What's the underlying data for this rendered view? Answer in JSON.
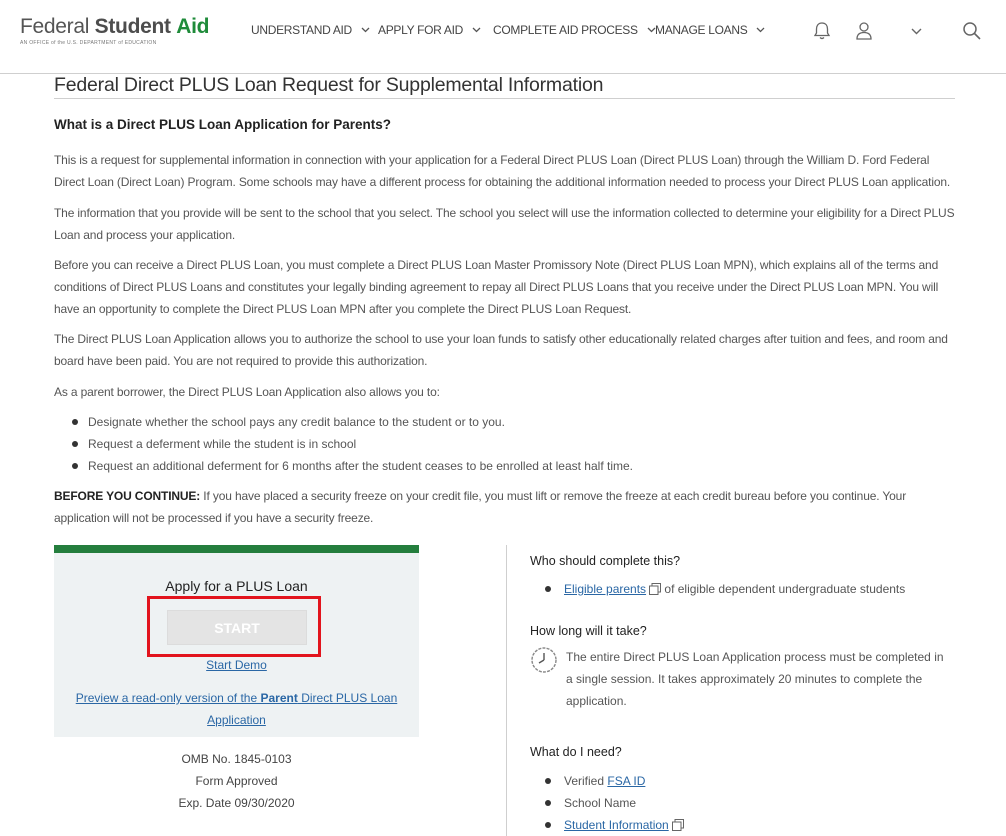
{
  "header": {
    "logo": {
      "word1": "Federal",
      "word2": "Student",
      "word3": "Aid",
      "tagline": "AN OFFICE of the U.S. DEPARTMENT of EDUCATION"
    },
    "nav": [
      {
        "label": "UNDERSTAND AID"
      },
      {
        "label": "APPLY FOR AID"
      },
      {
        "label": "COMPLETE AID PROCESS"
      },
      {
        "label": "MANAGE LOANS"
      }
    ],
    "icons": [
      "bell-icon",
      "user-icon",
      "chevron-down-icon",
      "search-icon"
    ]
  },
  "page": {
    "title": "Federal Direct PLUS Loan Request for Supplemental Information",
    "section_heading": "What is a Direct PLUS Loan Application for Parents?",
    "paragraphs": [
      "This is a request for supplemental information in connection with your application for a Federal Direct PLUS Loan (Direct PLUS Loan) through the William D. Ford Federal Direct Loan (Direct Loan) Program. Some schools may have a different process for obtaining the additional information needed to process your Direct PLUS Loan application.",
      "The information that you provide will be sent to the school that you select. The school you select will use the information collected to determine your eligibility for a Direct PLUS Loan and process your application.",
      "Before you can receive a Direct PLUS Loan, you must complete a Direct PLUS Loan Master Promissory Note (Direct PLUS Loan MPN), which explains all of the terms and conditions of Direct PLUS Loans and constitutes your legally binding agreement to repay all Direct PLUS Loans that you receive under the Direct PLUS Loan MPN. You will have an opportunity to complete the Direct PLUS Loan MPN after you complete the Direct PLUS Loan Request.",
      "The Direct PLUS Loan Application allows you to authorize the school to use your loan funds to satisfy other educationally related charges after tuition and fees, and room and board have been paid. You are not required to provide this authorization.",
      "As a parent borrower, the Direct PLUS Loan Application also allows you to:"
    ],
    "bullets": [
      "Designate whether the school pays any credit balance to the student or to you.",
      "Request a deferment while the student is in school",
      "Request an additional deferment for 6 months after the student ceases to be enrolled at least half time."
    ],
    "warning_label": "BEFORE YOU CONTINUE:",
    "warning_text": " If you have placed a security freeze on your credit file, you must lift or remove the freeze at each credit bureau before you continue. Your application will not be processed if you have a security freeze."
  },
  "apply": {
    "title": "Apply for a PLUS Loan",
    "start_label": "START",
    "demo_label": "Start Demo",
    "preview_pre": "Preview a read-only version of the ",
    "preview_bold": "Parent",
    "preview_post": " Direct PLUS Loan Application",
    "omb": "OMB No. 1845-0103",
    "form_status": "Form Approved",
    "exp_date": "Exp. Date 09/30/2020",
    "accent_color": "#247e3d",
    "highlight_color": "#e2141d"
  },
  "sidebar": {
    "who_heading": "Who should complete this?",
    "who_link": "Eligible parents",
    "who_text": " of eligible dependent undergraduate students",
    "time_heading": "How long will it take?",
    "time_text": "The entire Direct PLUS Loan Application process must be completed in a single session. It takes approximately 20 minutes to complete the application.",
    "need_heading": "What do I need?",
    "need_items": [
      {
        "prefix": "Verified ",
        "link": "FSA ID"
      },
      {
        "text": "School Name"
      },
      {
        "link": "Student Information"
      }
    ]
  }
}
